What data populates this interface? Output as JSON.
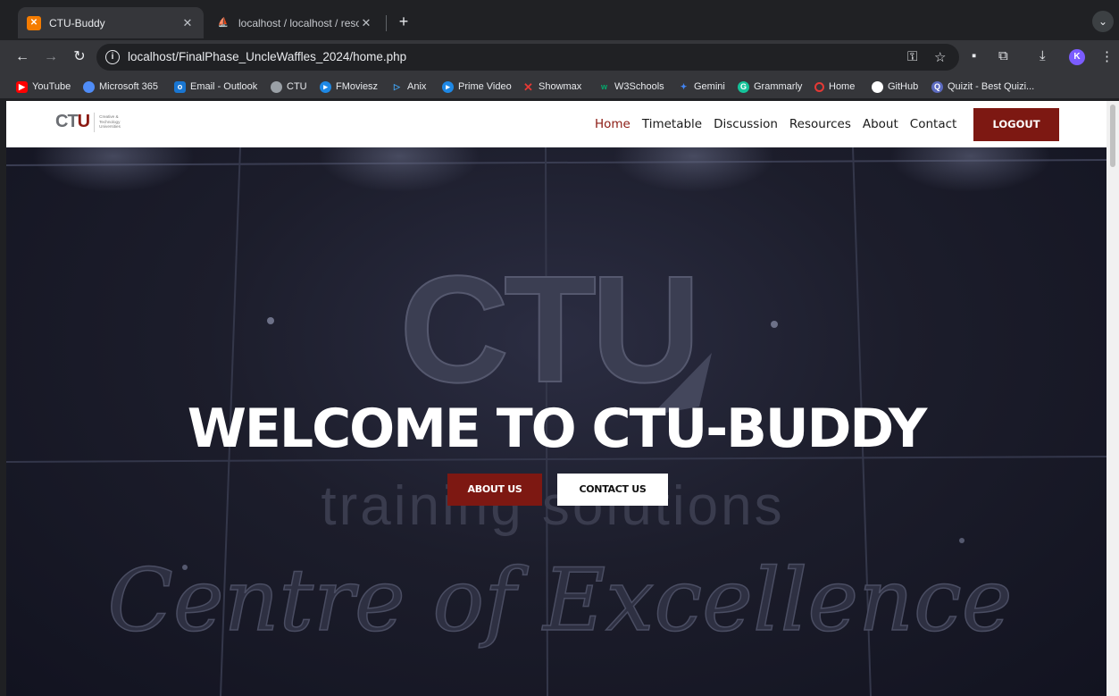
{
  "browser": {
    "tabs": [
      {
        "title": "CTU-Buddy",
        "active": true
      },
      {
        "title": "localhost / localhost / resourc",
        "active": false
      }
    ],
    "new_tab_symbol": "+",
    "url": "localhost/FinalPhase_UncleWaffles_2024/home.php",
    "profile_initial": "K",
    "bookmarks": [
      {
        "label": "YouTube",
        "icon": "youtube-icon",
        "color": "#ff0000"
      },
      {
        "label": "Microsoft 365",
        "icon": "microsoft365-icon",
        "color": "#4f8cf7"
      },
      {
        "label": "Email - Outlook",
        "icon": "outlook-icon",
        "color": "#1976d2"
      },
      {
        "label": "CTU",
        "icon": "globe-icon",
        "color": "#9aa0a6"
      },
      {
        "label": "FMoviesz",
        "icon": "play-icon",
        "color": "#1e88e5"
      },
      {
        "label": "Anix",
        "icon": "anix-icon",
        "color": "#42a5f5"
      },
      {
        "label": "Prime Video",
        "icon": "prime-video-icon",
        "color": "#1e88e5"
      },
      {
        "label": "Showmax",
        "icon": "showmax-icon",
        "color": "#e53935"
      },
      {
        "label": "W3Schools",
        "icon": "w3schools-icon",
        "color": "#04aa6d"
      },
      {
        "label": "Gemini",
        "icon": "gemini-icon",
        "color": "#4285f4"
      },
      {
        "label": "Grammarly",
        "icon": "grammarly-icon",
        "color": "#15c39a"
      },
      {
        "label": "Home",
        "icon": "opera-icon",
        "color": "#e53935"
      },
      {
        "label": "GitHub",
        "icon": "github-icon",
        "color": "#ffffff"
      },
      {
        "label": "Quizit - Best Quizi...",
        "icon": "quizit-icon",
        "color": "#5c6bc0"
      }
    ]
  },
  "site": {
    "logo": {
      "mark_left": "CT",
      "mark_right": "U",
      "line1": "Creative &",
      "line2": "Technology",
      "line3": "Universities"
    },
    "nav": [
      "Home",
      "Timetable",
      "Discussion",
      "Resources",
      "About",
      "Contact"
    ],
    "logout_label": "LOGOUT",
    "accent_color": "#7d1812"
  },
  "hero": {
    "title": "WELCOME TO CTU-BUDDY",
    "about_label": "ABOUT US",
    "contact_label": "CONTACT US",
    "bg_big_text": "CTU",
    "bg_line2": "training solutions",
    "bg_line3": "Centre of Excellence"
  }
}
